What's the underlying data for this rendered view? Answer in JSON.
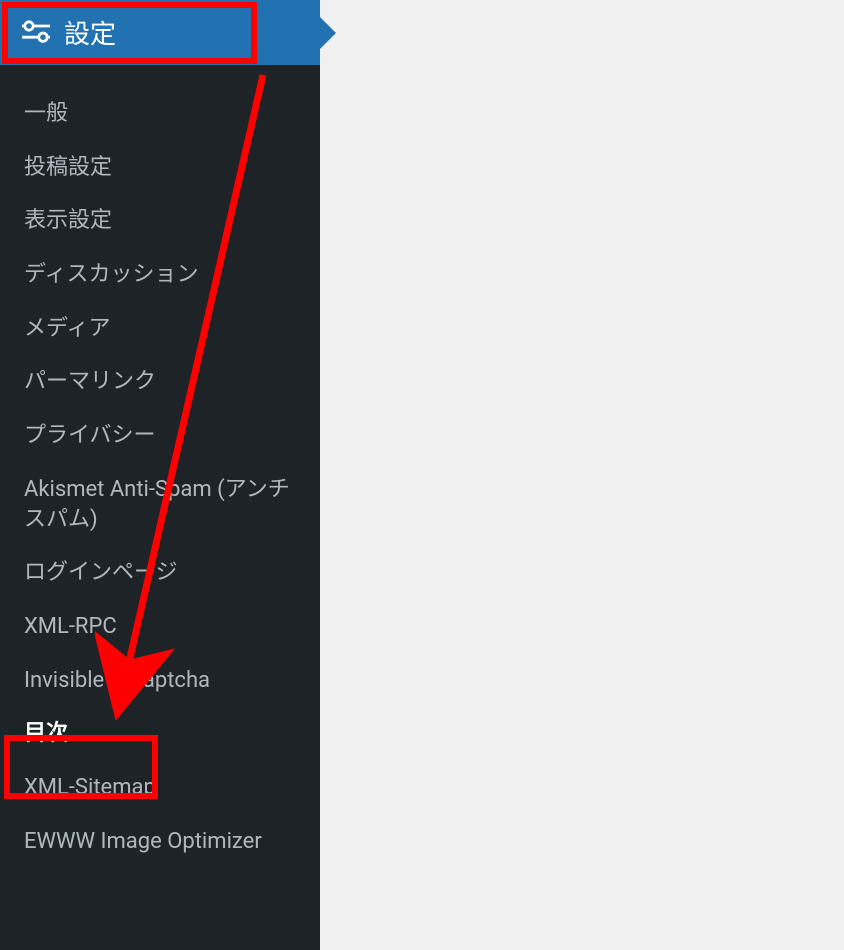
{
  "menu": {
    "header": {
      "icon": "settings-sliders-icon",
      "label": "設定"
    },
    "items": [
      {
        "label": "一般",
        "active": false
      },
      {
        "label": "投稿設定",
        "active": false
      },
      {
        "label": "表示設定",
        "active": false
      },
      {
        "label": "ディスカッション",
        "active": false
      },
      {
        "label": "メディア",
        "active": false
      },
      {
        "label": "パーマリンク",
        "active": false
      },
      {
        "label": "プライバシー",
        "active": false
      },
      {
        "label": "Akismet Anti-Spam (アンチスパム)",
        "active": false
      },
      {
        "label": "ログインページ",
        "active": false
      },
      {
        "label": "XML-RPC",
        "active": false
      },
      {
        "label": "Invisible reCaptcha",
        "active": false
      },
      {
        "label": "目次",
        "active": true
      },
      {
        "label": "XML-Sitemap",
        "active": false
      },
      {
        "label": "EWWW Image Optimizer",
        "active": false
      }
    ]
  }
}
